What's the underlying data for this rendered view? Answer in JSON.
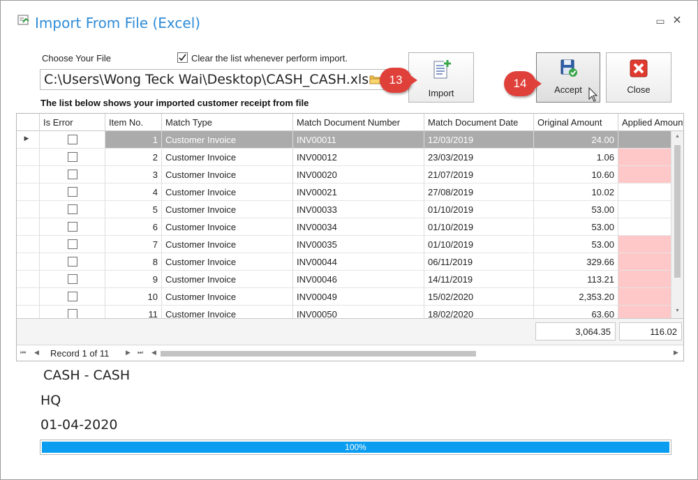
{
  "window": {
    "title": "Import From File (Excel)"
  },
  "form": {
    "file_label": "Choose Your File",
    "file_path": "C:\\Users\\Wong Teck Wai\\Desktop\\CASH_CASH.xls",
    "clear_checked": true,
    "clear_label": "Clear the list whenever perform import.",
    "list_heading": "The list below shows your imported customer receipt from file"
  },
  "toolbar": {
    "import_label": "Import",
    "accept_label": "Accept",
    "close_label": "Close"
  },
  "callouts": {
    "import_step": "13",
    "accept_step": "14"
  },
  "grid": {
    "columns": [
      "Is Error",
      "Item No.",
      "Match Type",
      "Match Document Number",
      "Match Document Date",
      "Original Amount",
      "Applied Amount"
    ],
    "rows": [
      {
        "is_error": false,
        "item_no": "1",
        "match_type": "Customer Invoice",
        "doc_no": "INV00011",
        "doc_date": "12/03/2019",
        "original": "24.00",
        "applied": "",
        "applied_error": false,
        "selected": true
      },
      {
        "is_error": false,
        "item_no": "2",
        "match_type": "Customer Invoice",
        "doc_no": "INV00012",
        "doc_date": "23/03/2019",
        "original": "1.06",
        "applied": "",
        "applied_error": true,
        "selected": false
      },
      {
        "is_error": false,
        "item_no": "3",
        "match_type": "Customer Invoice",
        "doc_no": "INV00020",
        "doc_date": "21/07/2019",
        "original": "10.60",
        "applied": "",
        "applied_error": true,
        "selected": false
      },
      {
        "is_error": false,
        "item_no": "4",
        "match_type": "Customer Invoice",
        "doc_no": "INV00021",
        "doc_date": "27/08/2019",
        "original": "10.02",
        "applied": "",
        "applied_error": false,
        "selected": false
      },
      {
        "is_error": false,
        "item_no": "5",
        "match_type": "Customer Invoice",
        "doc_no": "INV00033",
        "doc_date": "01/10/2019",
        "original": "53.00",
        "applied": "",
        "applied_error": false,
        "selected": false
      },
      {
        "is_error": false,
        "item_no": "6",
        "match_type": "Customer Invoice",
        "doc_no": "INV00034",
        "doc_date": "01/10/2019",
        "original": "53.00",
        "applied": "",
        "applied_error": false,
        "selected": false
      },
      {
        "is_error": false,
        "item_no": "7",
        "match_type": "Customer Invoice",
        "doc_no": "INV00035",
        "doc_date": "01/10/2019",
        "original": "53.00",
        "applied": "",
        "applied_error": true,
        "selected": false
      },
      {
        "is_error": false,
        "item_no": "8",
        "match_type": "Customer Invoice",
        "doc_no": "INV00044",
        "doc_date": "06/11/2019",
        "original": "329.66",
        "applied": "",
        "applied_error": true,
        "selected": false
      },
      {
        "is_error": false,
        "item_no": "9",
        "match_type": "Customer Invoice",
        "doc_no": "INV00046",
        "doc_date": "14/11/2019",
        "original": "113.21",
        "applied": "",
        "applied_error": true,
        "selected": false
      },
      {
        "is_error": false,
        "item_no": "10",
        "match_type": "Customer Invoice",
        "doc_no": "INV00049",
        "doc_date": "15/02/2020",
        "original": "2,353.20",
        "applied": "",
        "applied_error": true,
        "selected": false
      },
      {
        "is_error": false,
        "item_no": "11",
        "match_type": "Customer Invoice",
        "doc_no": "INV00050",
        "doc_date": "18/02/2020",
        "original": "63.60",
        "applied": "",
        "applied_error": true,
        "selected": false
      }
    ],
    "total_original": "3,064.35",
    "total_applied": "116.02",
    "record_text": "Record 1 of 11"
  },
  "info": {
    "account": "CASH - CASH",
    "branch": "HQ",
    "date": "01-04-2020"
  },
  "progress": {
    "percent": 100,
    "text": "100%"
  },
  "colors": {
    "title": "#2e8bd6",
    "selected_row": "#ababab",
    "error_cell": "#ffc8c8",
    "progress": "#0a9df0",
    "callout": "#e0403a"
  }
}
